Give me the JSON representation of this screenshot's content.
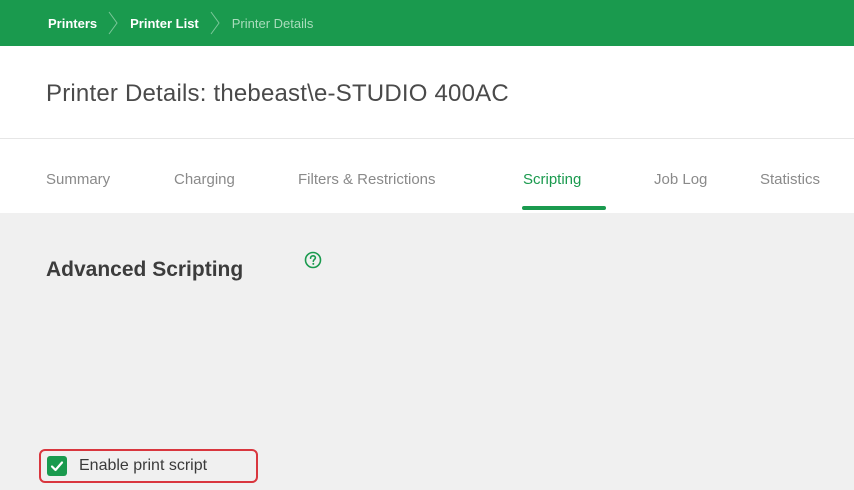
{
  "breadcrumb": {
    "items": [
      {
        "label": "Printers"
      },
      {
        "label": "Printer List"
      },
      {
        "label": "Printer Details"
      }
    ]
  },
  "header": {
    "title": "Printer Details: thebeast\\e-STUDIO 400AC"
  },
  "tabs": [
    {
      "label": "Summary",
      "active": false
    },
    {
      "label": "Charging",
      "active": false
    },
    {
      "label": "Filters & Restrictions",
      "active": false
    },
    {
      "label": "Scripting",
      "active": true
    },
    {
      "label": "Job Log",
      "active": false
    },
    {
      "label": "Statistics",
      "active": false
    }
  ],
  "section": {
    "title": "Advanced Scripting",
    "help_icon": "help-circle-icon"
  },
  "enable_print_script": {
    "label": "Enable print script",
    "checked": true
  },
  "colors": {
    "accent": "#1a9a4e",
    "highlight_border": "#d9363e",
    "content_bg": "#f0f0f0"
  }
}
